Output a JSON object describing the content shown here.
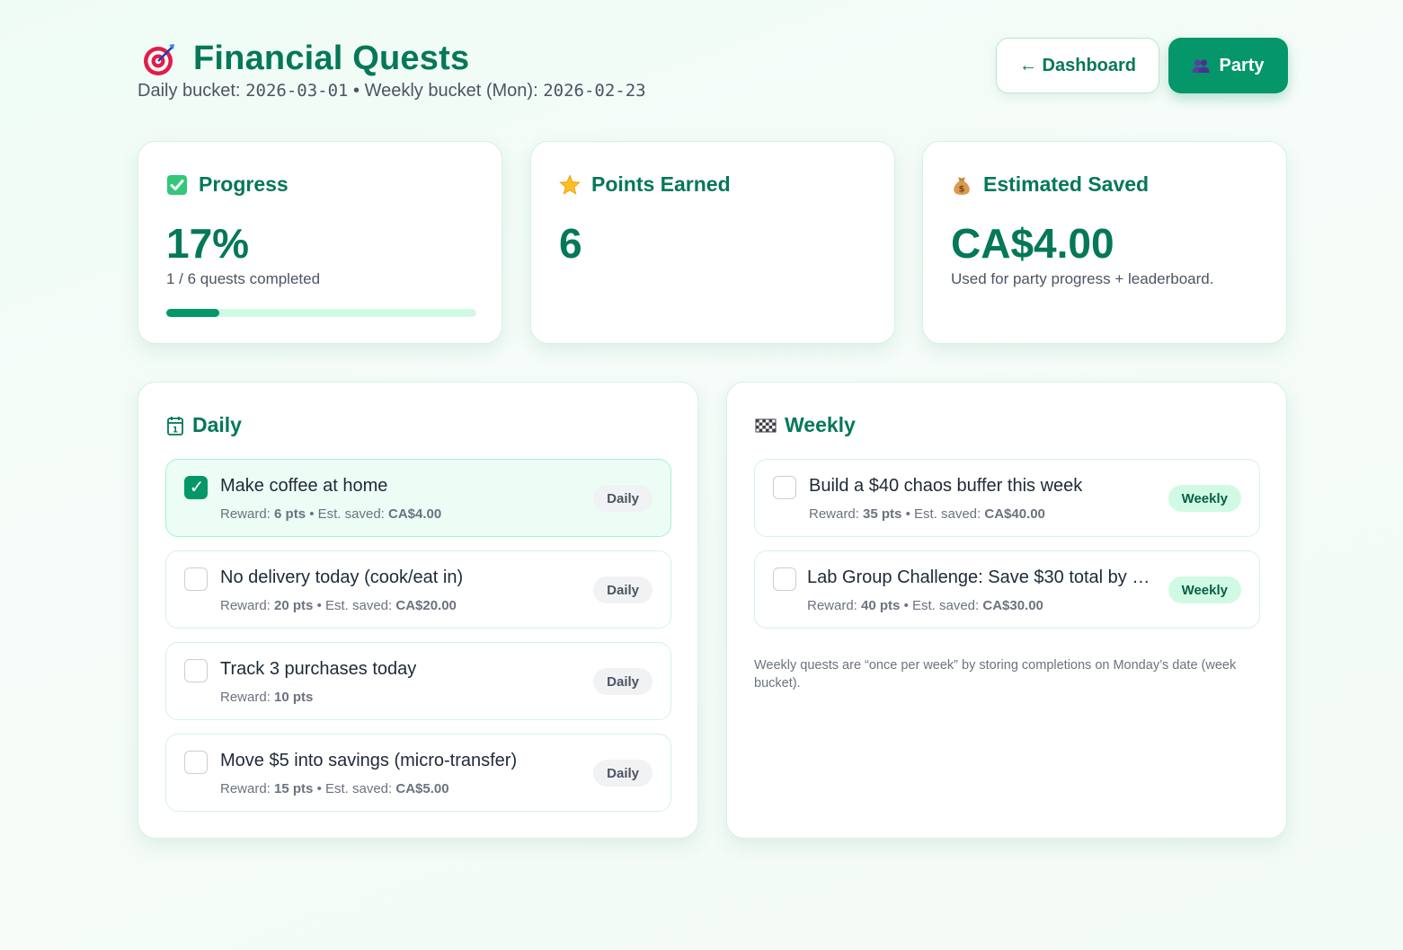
{
  "header": {
    "icon": "target-icon",
    "title": "Financial Quests",
    "subtitle_daily_label": "Daily bucket:",
    "daily_date": "2026-03-01",
    "separator": "•",
    "subtitle_weekly_label": "Weekly bucket (Mon):",
    "weekly_date": "2026-02-23",
    "dashboard_button": "← Dashboard",
    "party_button": "Party",
    "party_icon": "people-icon"
  },
  "stats": {
    "progress": {
      "icon": "check-box-icon",
      "label": "Progress",
      "value": "17%",
      "sub": "1 / 6 quests completed",
      "fraction": 0.17
    },
    "points": {
      "icon": "star-icon",
      "label": "Points Earned",
      "value": "6"
    },
    "saved": {
      "icon": "money-bag-icon",
      "label": "Estimated Saved",
      "value": "CA$4.00",
      "sub": "Used for party progress + leaderboard."
    }
  },
  "daily": {
    "icon": "calendar-icon",
    "title": "Daily",
    "quests": [
      {
        "title": "Make coffee at home",
        "reward_label": "Reward:",
        "points": "6 pts",
        "saved_label": "• Est. saved:",
        "saved": "CA$4.00",
        "tag": "Daily",
        "done": true
      },
      {
        "title": "No delivery today (cook/eat in)",
        "reward_label": "Reward:",
        "points": "20 pts",
        "saved_label": "• Est. saved:",
        "saved": "CA$20.00",
        "tag": "Daily",
        "done": false
      },
      {
        "title": "Track 3 purchases today",
        "reward_label": "Reward:",
        "points": "10 pts",
        "tag": "Daily",
        "done": false
      },
      {
        "title": "Move $5 into savings (micro-transfer)",
        "reward_label": "Reward:",
        "points": "15 pts",
        "saved_label": "• Est. saved:",
        "saved": "CA$5.00",
        "tag": "Daily",
        "done": false
      }
    ]
  },
  "weekly": {
    "icon": "checkered-flag-icon",
    "title": "Weekly",
    "quests": [
      {
        "title": "Build a $40 chaos buffer this week",
        "reward_label": "Reward:",
        "points": "35 pts",
        "saved_label": "• Est. saved:",
        "saved": "CA$40.00",
        "tag": "Weekly",
        "done": false
      },
      {
        "title": "Lab Group Challenge: Save $30 total by …",
        "reward_label": "Reward:",
        "points": "40 pts",
        "saved_label": "• Est. saved:",
        "saved": "CA$30.00",
        "tag": "Weekly",
        "done": false
      }
    ],
    "note": "Weekly quests are “once per week” by storing completions on Monday’s date (week bucket)."
  },
  "colors": {
    "accent": "#047857",
    "primary": "#059669",
    "progress_track": "#d1fae5"
  }
}
